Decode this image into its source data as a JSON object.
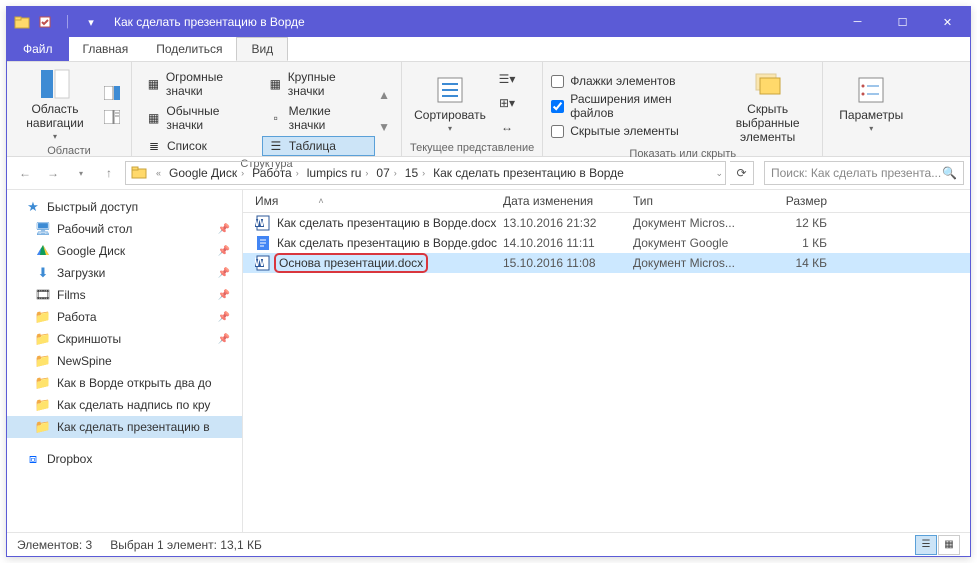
{
  "window": {
    "title": "Как сделать презентацию в Ворде"
  },
  "tabs": {
    "file": "Файл",
    "home": "Главная",
    "share": "Поделиться",
    "view": "Вид"
  },
  "ribbon": {
    "nav_pane": "Область навигации",
    "group_nav": "Области",
    "views": {
      "huge": "Огромные значки",
      "large": "Крупные значки",
      "normal": "Обычные значки",
      "small": "Мелкие значки",
      "list": "Список",
      "table": "Таблица"
    },
    "group_layout": "Структура",
    "sort": "Сортировать",
    "group_view": "Текущее представление",
    "check_items": "Флажки элементов",
    "check_ext": "Расширения имен файлов",
    "check_hidden": "Скрытые элементы",
    "hide_selected": "Скрыть выбранные элементы",
    "group_show": "Показать или скрыть",
    "options": "Параметры"
  },
  "breadcrumbs": [
    "Google Диск",
    "Работа",
    "lumpics ru",
    "07",
    "15",
    "Как сделать презентацию в Ворде"
  ],
  "search_placeholder": "Поиск: Как сделать презента...",
  "sidebar": {
    "quick": "Быстрый доступ",
    "items": [
      "Рабочий стол",
      "Google Диск",
      "Загрузки",
      "Films",
      "Работа",
      "Скриншоты",
      "NewSpine",
      "Как в Ворде открыть два до",
      "Как сделать надпись по кру",
      "Как сделать презентацию в"
    ],
    "dropbox": "Dropbox"
  },
  "columns": {
    "name": "Имя",
    "date": "Дата изменения",
    "type": "Тип",
    "size": "Размер"
  },
  "files": [
    {
      "name": "Как сделать презентацию в Ворде.docx",
      "date": "13.10.2016 21:32",
      "type": "Документ Micros...",
      "size": "12 КБ",
      "icon": "word"
    },
    {
      "name": "Как сделать презентацию в Ворде.gdoc",
      "date": "14.10.2016 11:11",
      "type": "Документ Google",
      "size": "1 КБ",
      "icon": "gdoc"
    },
    {
      "name": "Основа презентации.docx",
      "date": "15.10.2016 11:08",
      "type": "Документ Micros...",
      "size": "14 КБ",
      "icon": "word"
    }
  ],
  "status": {
    "count": "Элементов: 3",
    "selection": "Выбран 1 элемент: 13,1 КБ"
  }
}
